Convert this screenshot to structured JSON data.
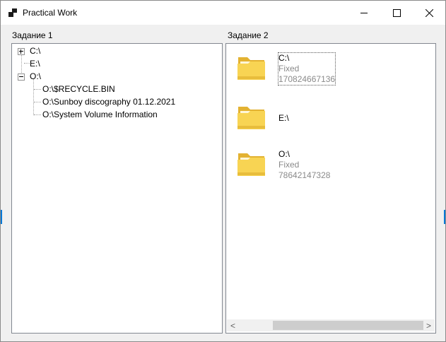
{
  "window": {
    "title": "Practical Work"
  },
  "controls": {
    "minimize": "minimize",
    "maximize": "maximize",
    "close": "close"
  },
  "task1": {
    "label": "Задание 1",
    "tree": [
      {
        "text": "C:\\",
        "expander": "plus",
        "level": 0
      },
      {
        "text": "E:\\",
        "expander": "none",
        "level": 0
      },
      {
        "text": "O:\\",
        "expander": "minus",
        "level": 0
      },
      {
        "text": "O:\\$RECYCLE.BIN",
        "expander": "none",
        "level": 1
      },
      {
        "text": "O:\\Sunboy discography 01.12.2021",
        "expander": "none",
        "level": 1
      },
      {
        "text": "O:\\System Volume Information",
        "expander": "none",
        "level": 1
      }
    ]
  },
  "task2": {
    "label": "Задание 2",
    "items": [
      {
        "name": "C:\\",
        "type": "Fixed",
        "size": "170824667136",
        "icon": "folder-icon"
      },
      {
        "name": "E:\\",
        "type": "",
        "size": "",
        "icon": "folder-icon"
      },
      {
        "name": "O:\\",
        "type": "Fixed",
        "size": "78642147328",
        "icon": "folder-icon"
      }
    ],
    "scrollbar": {
      "left_arrow": "<",
      "right_arrow": ">"
    }
  },
  "colors": {
    "folder_front": "#f7d55a",
    "folder_back": "#e8b83a",
    "accent": "#0078d7"
  }
}
